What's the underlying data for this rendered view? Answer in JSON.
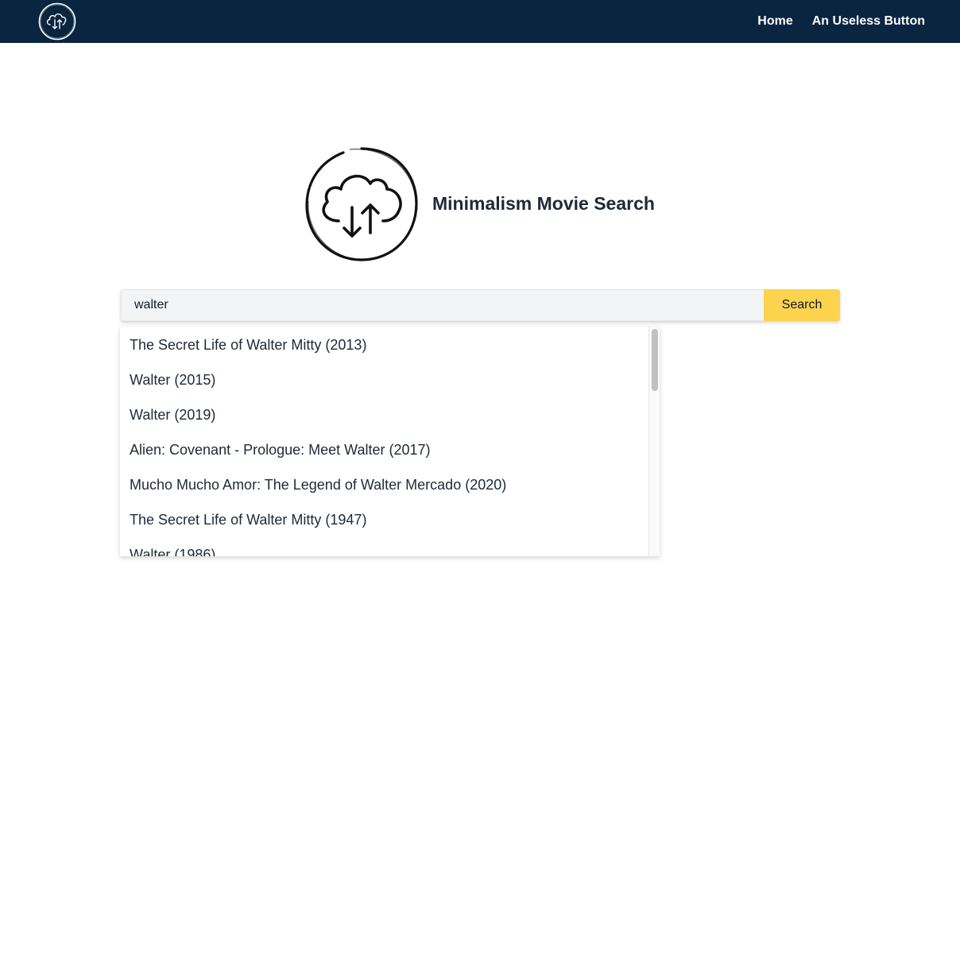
{
  "navbar": {
    "logo_icon": "cloud-sync-icon",
    "links": [
      {
        "label": "Home"
      },
      {
        "label": "An Useless Button"
      }
    ],
    "background_color": "#0a2540"
  },
  "hero": {
    "logo_icon": "cloud-sync-icon",
    "title": "Minimalism Movie Search"
  },
  "search": {
    "value": "walter",
    "placeholder": "",
    "button_label": "Search",
    "button_color": "#fcd34d"
  },
  "suggestions": {
    "items": [
      {
        "label": "The Secret Life of Walter Mitty (2013)"
      },
      {
        "label": "Walter (2015)"
      },
      {
        "label": "Walter (2019)"
      },
      {
        "label": "Alien: Covenant - Prologue: Meet Walter (2017)"
      },
      {
        "label": "Mucho Mucho Amor: The Legend of Walter Mercado (2020)"
      },
      {
        "label": "The Secret Life of Walter Mitty (1947)"
      },
      {
        "label": "Walter (1986)"
      }
    ]
  }
}
